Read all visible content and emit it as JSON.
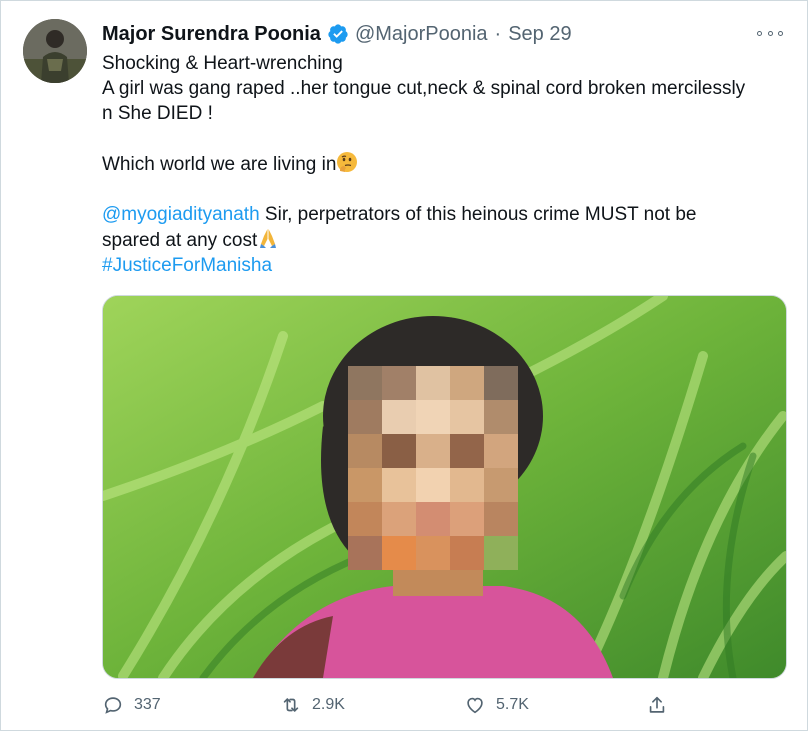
{
  "tweet": {
    "author_name": "Major Surendra Poonia",
    "handle": "@MajorPoonia",
    "separator": "·",
    "date": "Sep 29",
    "lines": {
      "l1": "Shocking & Heart-wrenching",
      "l2": "A girl was gang raped ..her tongue cut,neck & spinal cord broken mercilessly",
      "l3": "n She DIED !",
      "l4": "Which world we are living in",
      "mention": "@myogiadityanath",
      "l5_rest": " Sir, perpetrators of this heinous crime MUST not be",
      "l6": "spared at any cost",
      "hashtag": "#JusticeForManisha"
    },
    "actions": {
      "replies": "337",
      "retweets": "2.9K",
      "likes": "5.7K"
    }
  },
  "colors": {
    "link": "#1d9bf0",
    "verified": "#1d9bf0",
    "muted": "#536471"
  },
  "icons": {
    "verified": "verified-badge-icon",
    "more": "more-options-icon",
    "reply": "reply-icon",
    "retweet": "retweet-icon",
    "like": "like-icon",
    "share": "share-icon",
    "thinking": "thinking-face-emoji",
    "pray": "folded-hands-emoji"
  }
}
